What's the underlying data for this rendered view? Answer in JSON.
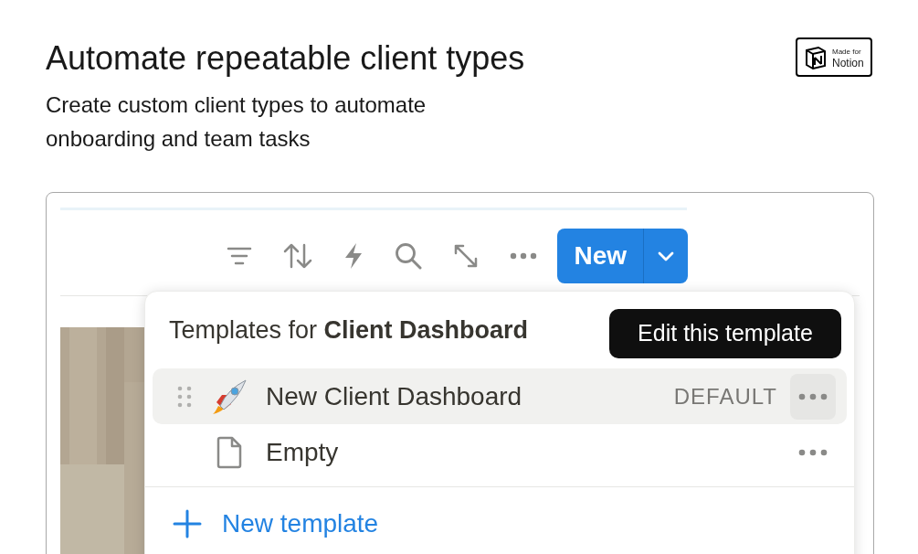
{
  "heading": "Automate repeatable client types",
  "subtitle": "Create custom client types to automate onboarding and team tasks",
  "badge": {
    "line_1": "Made for",
    "line_2": "Notion"
  },
  "new_button": {
    "label": "New"
  },
  "templates_menu": {
    "title": "Templates for **Client Dashboard**",
    "tooltip": "Edit this template",
    "items": [
      {
        "kind": "rocket",
        "label": "New Client Dashboard",
        "tag": "DEFAULT",
        "hovered": true
      },
      {
        "kind": "page",
        "label": "Empty",
        "hovered": false
      }
    ],
    "add_label": "New template"
  }
}
